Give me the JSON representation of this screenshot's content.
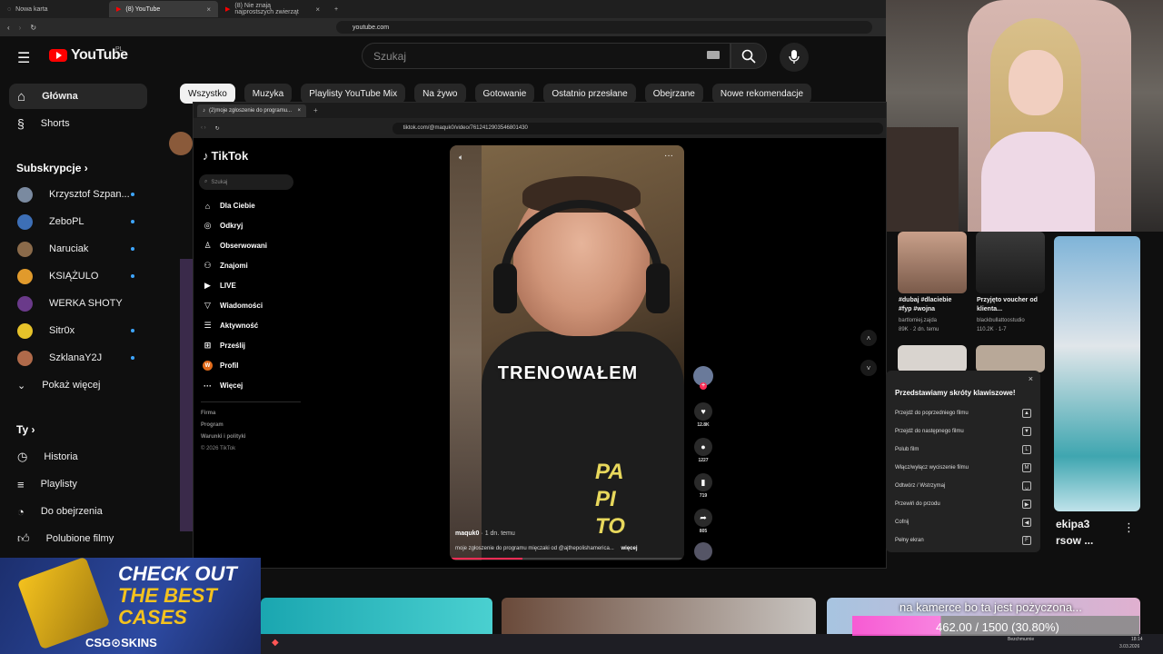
{
  "outer_browser": {
    "tabs": [
      {
        "label": "Nowa karta"
      },
      {
        "label": "(8) YouTube"
      },
      {
        "label": "(8) Nie znają najprostszych zwierząt"
      }
    ],
    "url": "youtube.com"
  },
  "youtube": {
    "logo": "YouTube",
    "region": "PL",
    "search_placeholder": "Szukaj",
    "sidebar": {
      "main": [
        {
          "label": "Główna"
        },
        {
          "label": "Shorts"
        }
      ],
      "subs_heading": "Subskrypcje",
      "subs": [
        {
          "label": "Krzysztof Szpan..."
        },
        {
          "label": "ZeboPL"
        },
        {
          "label": "Naruciak"
        },
        {
          "label": "KSIĄŻULO"
        },
        {
          "label": "WERKA SHOTY"
        },
        {
          "label": "Sitr0x"
        },
        {
          "label": "SzklanaY2J"
        }
      ],
      "show_more": "Pokaż więcej",
      "you_heading": "Ty",
      "you_items": [
        {
          "label": "Historia"
        },
        {
          "label": "Playlisty"
        },
        {
          "label": "Do obejrzenia"
        },
        {
          "label": "Polubione filmy"
        }
      ]
    },
    "chips": [
      "Wszystko",
      "Muzyka",
      "Playlisty YouTube Mix",
      "Na żywo",
      "Gotowanie",
      "Ostatnio przesłane",
      "Obejrzane",
      "Nowe rekomendacje"
    ],
    "shorts": [
      {
        "title": "#dubaj #dlaciebie #fyp #wojna",
        "author": "bartlomiej.zajda",
        "stats": "89K · 2 dn. temu"
      },
      {
        "title": "Przyjęto voucher od klienta...",
        "author": "blackbullattoostudio",
        "stats": "110.2K · 1-7"
      }
    ],
    "right_title": "ekipa3",
    "right_sub": "rsow ..."
  },
  "tiktok_browser": {
    "tab_label": "(2)moje zgłoszenie do programu...",
    "url": "tiktok.com/@maquk0/video/7612412903546801430"
  },
  "tiktok": {
    "logo": "TikTok",
    "search_placeholder": "Szukaj",
    "nav": [
      {
        "label": "Dla Ciebie",
        "icon": "home-icon",
        "glyph": "⌂"
      },
      {
        "label": "Odkryj",
        "icon": "compass-icon",
        "glyph": "◎"
      },
      {
        "label": "Obserwowani",
        "icon": "following-icon",
        "glyph": "♙"
      },
      {
        "label": "Znajomi",
        "icon": "friends-icon",
        "glyph": "⚇"
      },
      {
        "label": "LIVE",
        "icon": "live-icon",
        "glyph": "▶"
      },
      {
        "label": "Wiadomości",
        "icon": "messages-icon",
        "glyph": "▽"
      },
      {
        "label": "Aktywność",
        "icon": "activity-icon",
        "glyph": "☰"
      },
      {
        "label": "Prześlij",
        "icon": "upload-icon",
        "glyph": "⊞"
      },
      {
        "label": "Profil",
        "icon": "profile-icon",
        "glyph": "W"
      },
      {
        "label": "Więcej",
        "icon": "more-icon",
        "glyph": "···"
      }
    ],
    "footer": [
      "Firma",
      "Program",
      "Warunki i polityki",
      "© 2026 TikTok"
    ],
    "video": {
      "caption_overlay": "TRENOWAŁEM",
      "shirt_text": [
        "PA",
        "PI",
        "TO"
      ],
      "author": "maquk0",
      "time": " · 1 dn. temu",
      "description": "moje zgłoszenie do programu mięczaki od @ajthepolishamerica...",
      "more": "więcej"
    },
    "actions": {
      "likes": "12.8K",
      "comments": "1227",
      "saves": "719",
      "shares": "805"
    }
  },
  "shortcuts_popup": {
    "title": "Przedstawiamy skróty klawiszowe!",
    "rows": [
      {
        "label": "Przejdź do poprzedniego filmu",
        "key": "▲"
      },
      {
        "label": "Przejdź do następnego filmu",
        "key": "▼"
      },
      {
        "label": "Polub film",
        "key": "L"
      },
      {
        "label": "Włącz/wyłącz wyciszenie filmu",
        "key": "M"
      },
      {
        "label": "Odtwórz / Wstrzymaj",
        "key": "␣"
      },
      {
        "label": "Przewiń do przodu",
        "key": "▶"
      },
      {
        "label": "Cofnij",
        "key": "◀"
      },
      {
        "label": "Pełny ekran",
        "key": "F"
      }
    ]
  },
  "overlays": {
    "csgo_line1": "CHECK OUT",
    "csgo_line2": "THE BEST",
    "csgo_line3": "CASES",
    "csgo_brand": "CSG⊙SKINS",
    "camera_text": "na kamerce bo ta jest pożyczona...",
    "goal_text": "462.00 / 1500 (30.80%)",
    "goal_fraction": 0.308
  },
  "taskbar": {
    "time": "18:14",
    "date": "3.03.2026",
    "weather": "Bezchmurnie"
  },
  "colors": {
    "yt_red": "#ff0000",
    "tiktok_red": "#fe2c55",
    "goal_pink": "#ff4fd2"
  }
}
